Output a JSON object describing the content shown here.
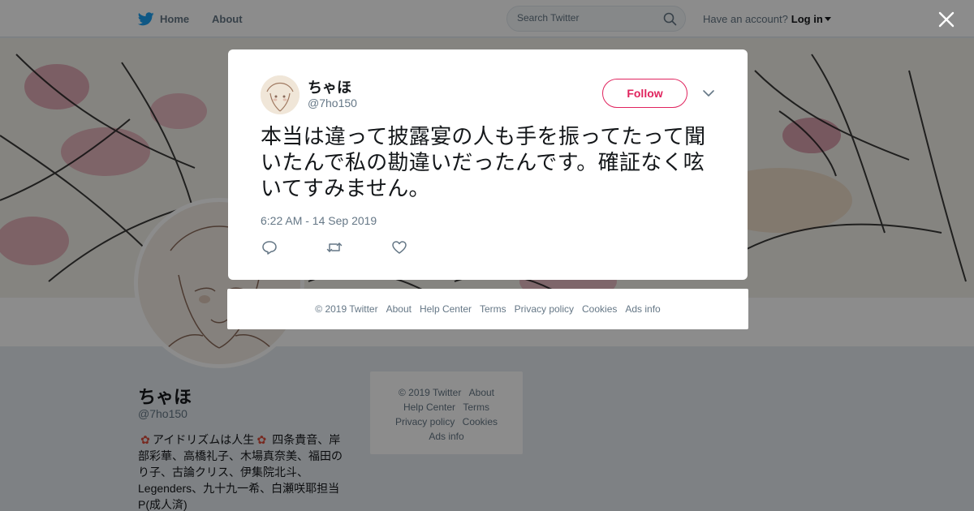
{
  "nav": {
    "home_label": "Home",
    "about_label": "About",
    "search_placeholder": "Search Twitter",
    "account_prompt": "Have an account?",
    "login_label": "Log in"
  },
  "profile": {
    "name": "ちゃほ",
    "handle": "@7ho150",
    "bio_1": "アイドリズムは人生",
    "bio_2": " 四条貴音、岸部彩華、高橋礼子、木場真奈美、福田のり子、古論クリス、伊集院北斗、Legenders、九十九一希、白瀬咲耶担当P(成人済)"
  },
  "side_footer": {
    "copyright": "© 2019 Twitter",
    "about": "About",
    "help": "Help Center",
    "terms": "Terms",
    "privacy": "Privacy policy",
    "cookies": "Cookies",
    "ads": "Ads info"
  },
  "tweet": {
    "author_name": "ちゃほ",
    "author_handle": "@7ho150",
    "follow_label": "Follow",
    "text": "本当は違って披露宴の人も手を振ってたって聞いたんで私の勘違いだったんです。確証なく呟いてすみません。",
    "timestamp": "6:22 AM - 14 Sep 2019"
  },
  "modal_footer": {
    "copyright": "© 2019 Twitter",
    "about": "About",
    "help": "Help Center",
    "terms": "Terms",
    "privacy": "Privacy policy",
    "cookies": "Cookies",
    "ads": "Ads info"
  },
  "colors": {
    "brand_blue": "#1da1f2",
    "follow_red": "#e0245e",
    "secondary_text": "#657786"
  },
  "icons": {
    "logo": "twitter-bird-icon",
    "search": "search-icon",
    "close": "close-icon",
    "more": "chevron-down-icon",
    "reply": "reply-icon",
    "retweet": "retweet-icon",
    "like": "heart-icon"
  }
}
